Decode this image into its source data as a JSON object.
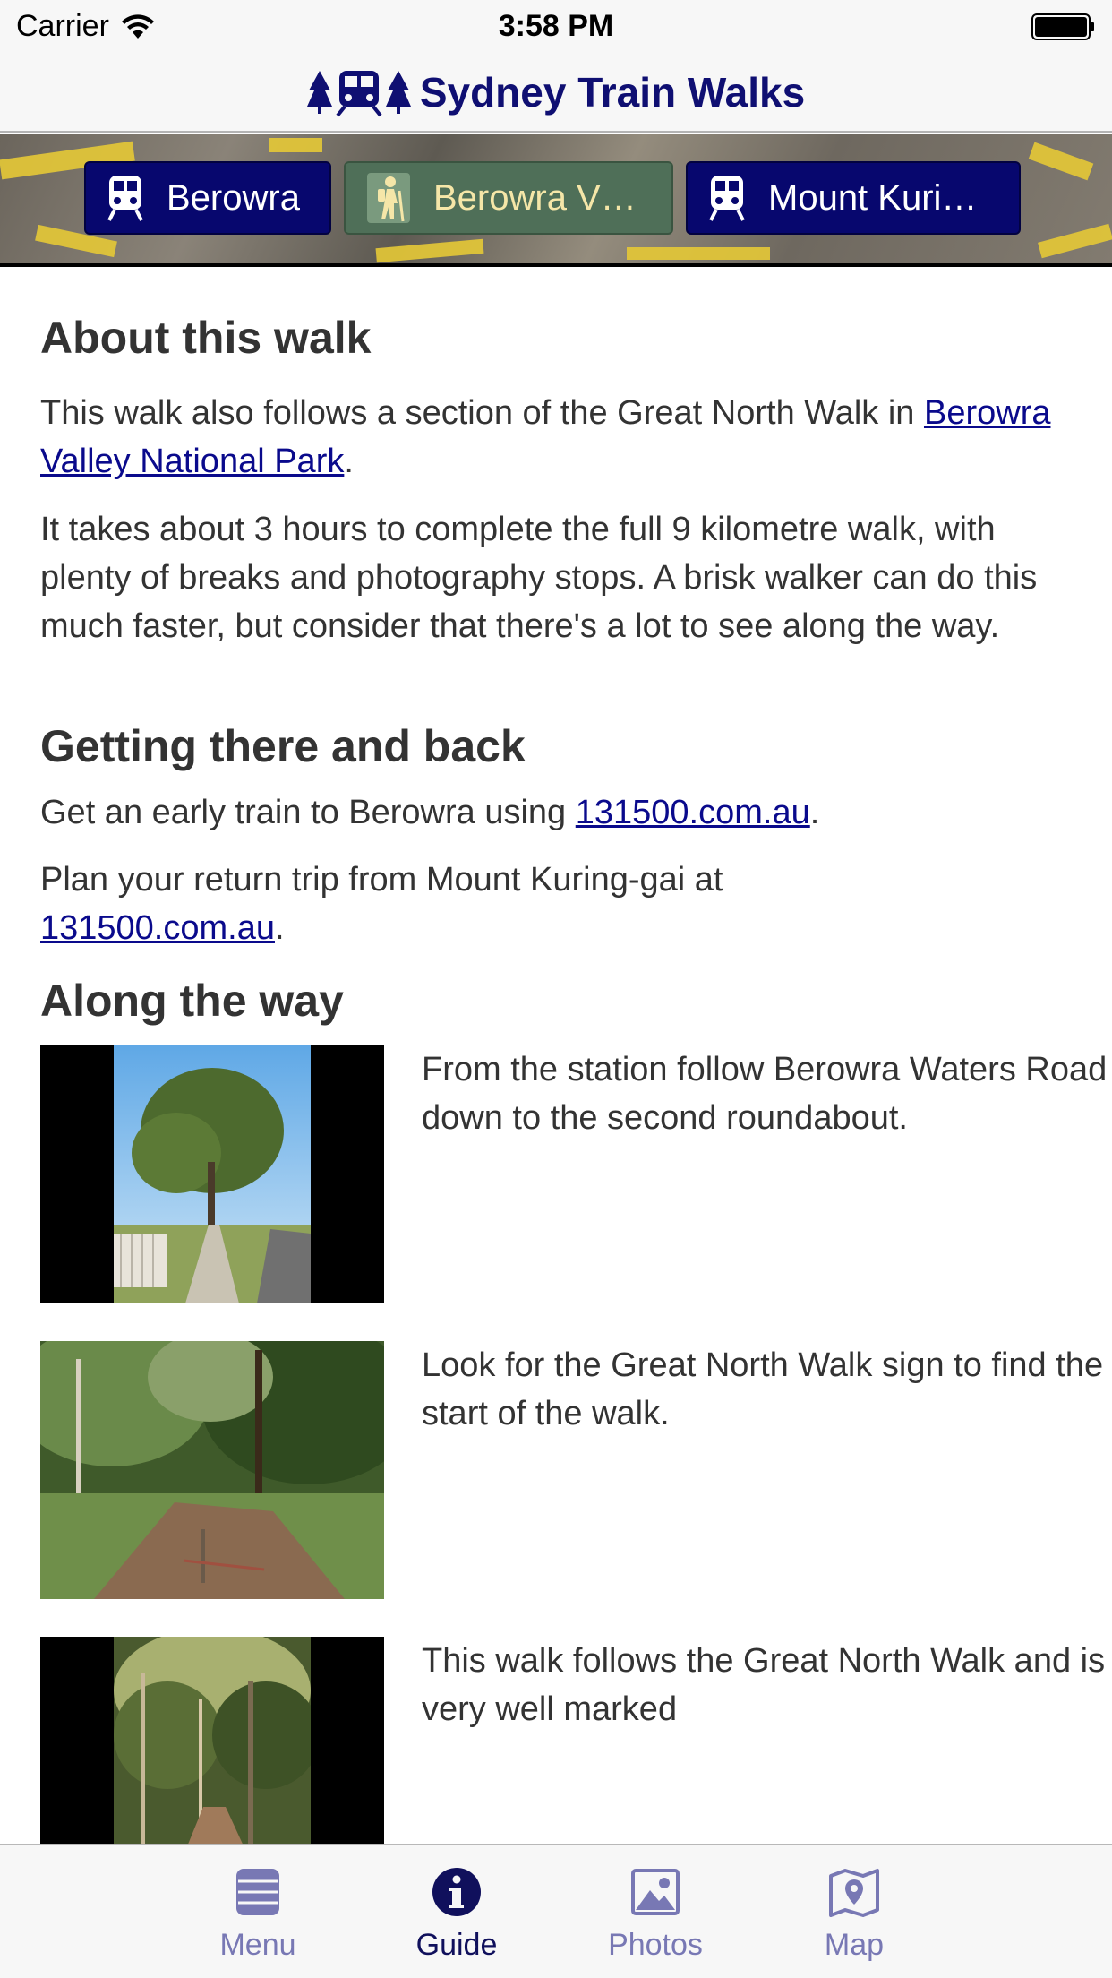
{
  "status_bar": {
    "carrier": "Carrier",
    "time": "3:58 PM"
  },
  "nav": {
    "title": "Sydney Train Walks"
  },
  "strip_tabs": [
    {
      "label": "Berowra",
      "icon": "train-icon"
    },
    {
      "label": "Berowra V…",
      "icon": "hiker-icon"
    },
    {
      "label": "Mount Kuri…",
      "icon": "train-icon"
    }
  ],
  "about": {
    "heading": "About this walk",
    "p1_text": "This walk also follows a section of the Great North Walk in",
    "p1_link": "Berowra Valley National Park",
    "p1_end": ".",
    "p2": "It takes about 3 hours to complete the full 9 kilometre walk, with plenty of breaks and photography stops. A brisk walker can do this much faster, but consider that there's a lot to see along the way."
  },
  "getting": {
    "heading": "Getting there and back",
    "p1_text": "Get an early train to Berowra using ",
    "p1_link": "131500.com.au",
    "p1_end": ".",
    "p2_text": "Plan your return trip from Mount Kuring-gai at",
    "p2_link": "131500.com.au",
    "p2_end": "."
  },
  "along": {
    "heading": "Along the way",
    "steps": [
      {
        "text": "From the station follow Berowra Waters Road down to the second roundabout."
      },
      {
        "text": "Look for the Great North Walk sign to find the start of the walk."
      },
      {
        "text": "This walk follows the Great North Walk and is very well marked"
      }
    ]
  },
  "tab_bar": {
    "items": [
      {
        "label": "Menu",
        "icon": "menu-icon"
      },
      {
        "label": "Guide",
        "icon": "info-icon",
        "active": true
      },
      {
        "label": "Photos",
        "icon": "photos-icon"
      },
      {
        "label": "Map",
        "icon": "map-icon"
      }
    ]
  },
  "colors": {
    "brand": "#0f0f72",
    "tab_active": "#10105c",
    "tab_inactive": "#7878b4",
    "link": "#0a0a8c"
  }
}
